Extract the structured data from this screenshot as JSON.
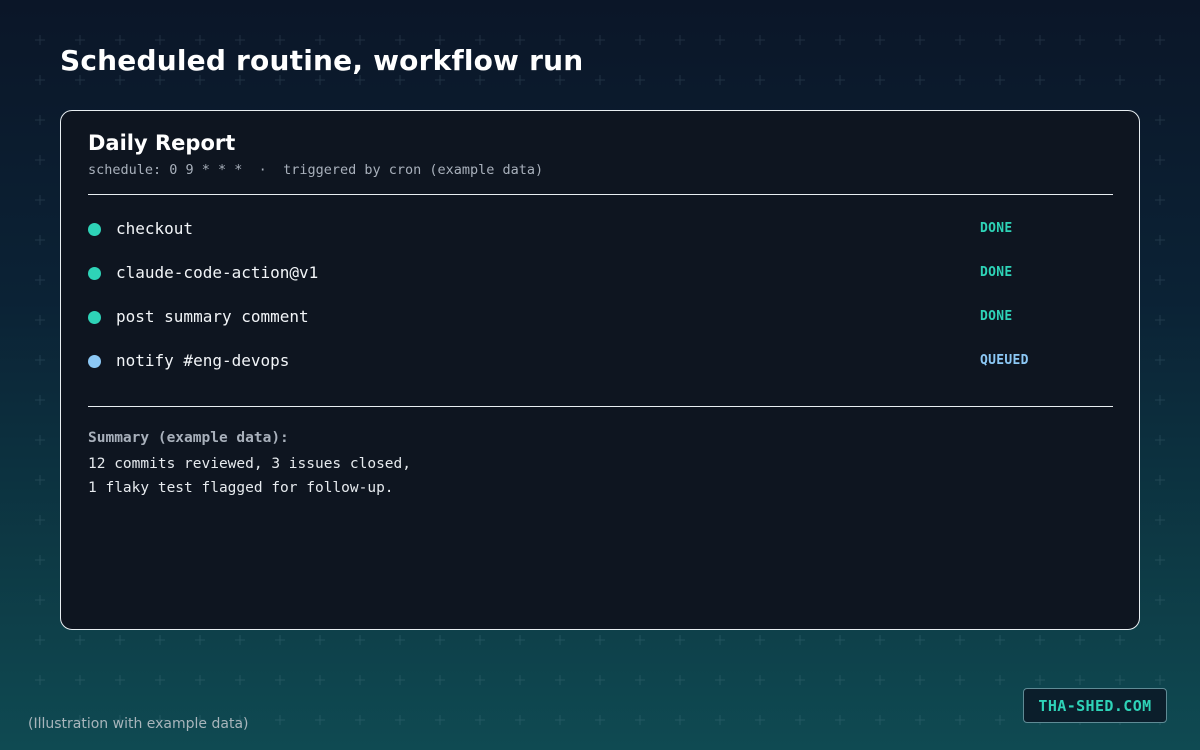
{
  "page": {
    "title": "Scheduled routine, workflow run",
    "footnote": "(Illustration with example data)",
    "brand": "THA-SHED.COM"
  },
  "colors": {
    "accent_done": "#2ed3b7",
    "accent_queued": "#8cc8f5",
    "card_background": "#0e1520",
    "card_border": "#e8eef2"
  },
  "icons": {
    "background_pattern": "plus-sign-grid",
    "step_status_indicator": "filled-circle"
  },
  "card": {
    "title": "Daily Report",
    "subtitle": "schedule: 0 9 * * *  ·  triggered by cron (example data)"
  },
  "steps": [
    {
      "name": "checkout",
      "status": "DONE"
    },
    {
      "name": "claude-code-action@v1",
      "status": "DONE"
    },
    {
      "name": "post summary comment",
      "status": "DONE"
    },
    {
      "name": "notify #eng-devops",
      "status": "QUEUED"
    }
  ],
  "summary": {
    "label": "Summary (example data):",
    "lines": [
      "12 commits reviewed, 3 issues closed,",
      "1 flaky test flagged for follow-up."
    ]
  }
}
